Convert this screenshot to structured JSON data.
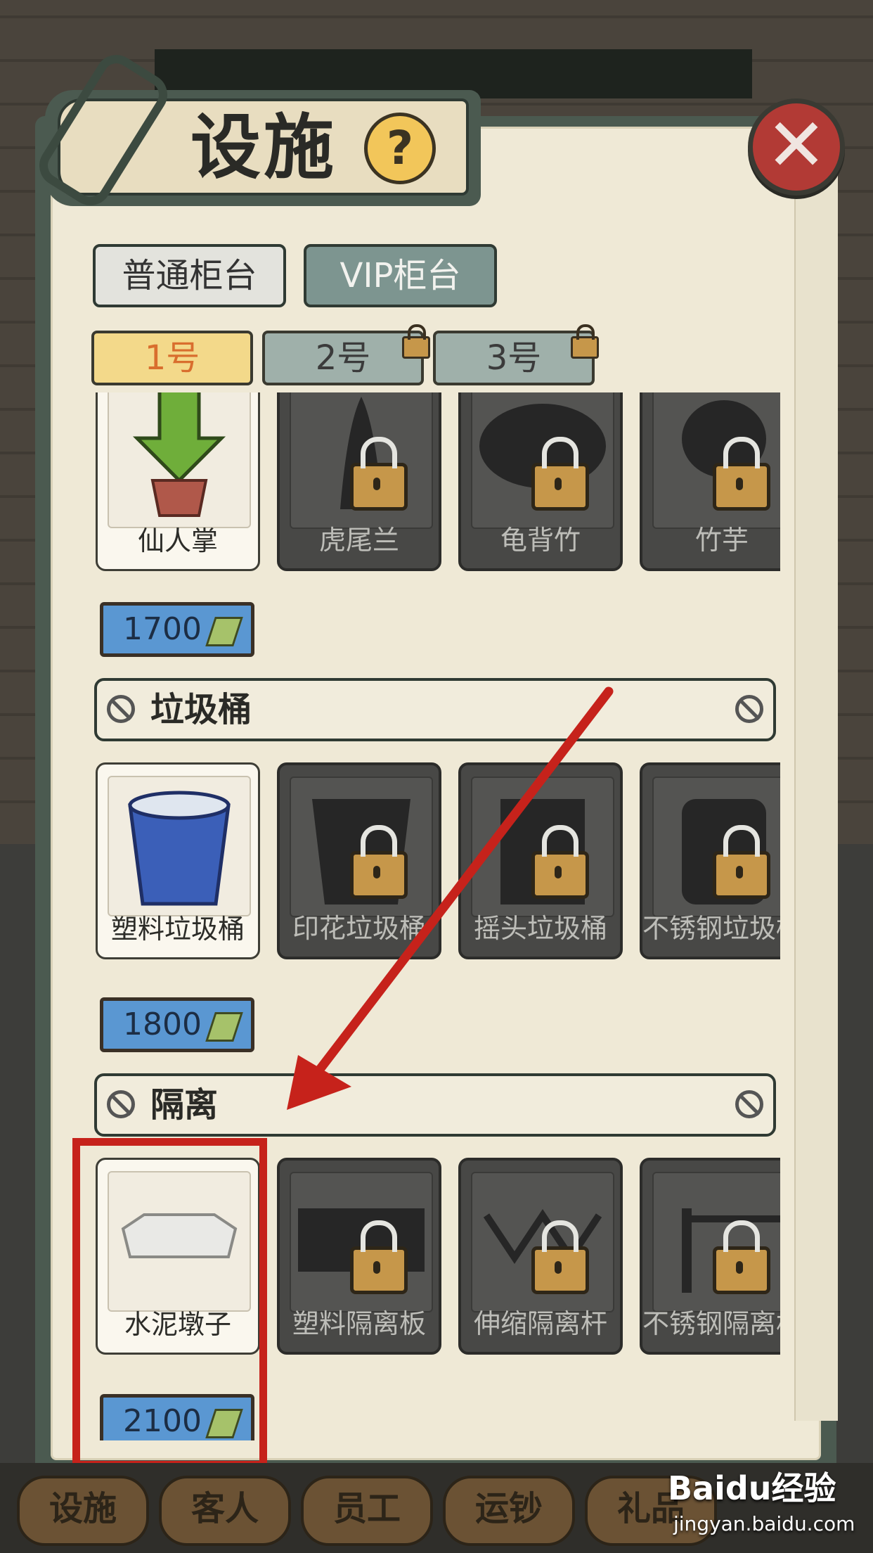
{
  "header": {
    "title": "设施",
    "help_label": "?",
    "close_label": "✕"
  },
  "counter_tabs": [
    "普通柜台",
    "VIP柜台"
  ],
  "counter_numbers": [
    {
      "label": "1号",
      "selected": true,
      "locked": false
    },
    {
      "label": "2号",
      "selected": false,
      "locked": true
    },
    {
      "label": "3号",
      "selected": false,
      "locked": true
    }
  ],
  "sections": [
    {
      "title": "",
      "items": [
        {
          "name": "仙人掌",
          "locked": false
        },
        {
          "name": "虎尾兰",
          "locked": true
        },
        {
          "name": "龟背竹",
          "locked": true
        },
        {
          "name": "竹芋",
          "locked": true
        }
      ],
      "price": "1700"
    },
    {
      "title": "垃圾桶",
      "items": [
        {
          "name": "塑料垃圾桶",
          "locked": false
        },
        {
          "name": "印花垃圾桶",
          "locked": true
        },
        {
          "name": "摇头垃圾桶",
          "locked": true
        },
        {
          "name": "不锈钢垃圾桶",
          "locked": true
        }
      ],
      "price": "1800"
    },
    {
      "title": "隔离",
      "items": [
        {
          "name": "水泥墩子",
          "locked": false
        },
        {
          "name": "塑料隔离板",
          "locked": true
        },
        {
          "name": "伸缩隔离杆",
          "locked": true
        },
        {
          "name": "不锈钢隔离杆",
          "locked": true
        }
      ],
      "price": "2100"
    }
  ],
  "bottom_nav": [
    "设施",
    "客人",
    "员工",
    "运钞",
    "礼品"
  ],
  "watermark": {
    "brand": "Baidu经验",
    "url": "jingyan.baidu.com"
  },
  "colors": {
    "annotation_red": "#c6221b",
    "selected_tab": "#f3d98a",
    "price_blue": "#5a97d2"
  }
}
